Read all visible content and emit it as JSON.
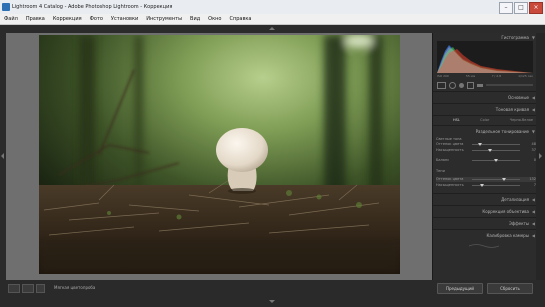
{
  "window": {
    "title": "Lightroom 4 Catalog - Adobe Photoshop Lightroom - Коррекция",
    "minimize": "–",
    "maximize": "□",
    "close": "×"
  },
  "menu": [
    "Файл",
    "Правка",
    "Коррекция",
    "Фото",
    "Установки",
    "Инструменты",
    "Вид",
    "Окно",
    "Справка"
  ],
  "right_panel": {
    "histogram_label": "Гистограмма",
    "histogram_stats": [
      "ISO 200",
      "55 мм",
      "f / 2.8",
      "1/125 сек"
    ],
    "basic": "Основные",
    "tone_curve": "Тоновая кривая",
    "tabs": [
      "HSL",
      "Color",
      "Черно-белое"
    ],
    "split_toning": "Раздельное тонирование",
    "highlights_label": "Светлые тона",
    "hue_label": "Оттенок цвета",
    "saturation_label": "Насыщенность",
    "balance_label": "Баланс",
    "shadows_label": "Тени",
    "highlights_hue": "48",
    "highlights_sat": "37",
    "balance_val": "0",
    "shadows_hue": "132",
    "shadows_sat": "7",
    "detail": "Детализация",
    "lens_corrections": "Коррекция объектива",
    "effects": "Эффекты",
    "camera_calibration": "Калибровка камеры"
  },
  "bottom": {
    "view_mode": "Мягкая цветопроба",
    "previous_button": "Предыдущий",
    "reset_button": "Сбросить"
  },
  "colors": {
    "panel_bg": "#2c2c2c",
    "workspace_bg": "#6f6f6f"
  }
}
